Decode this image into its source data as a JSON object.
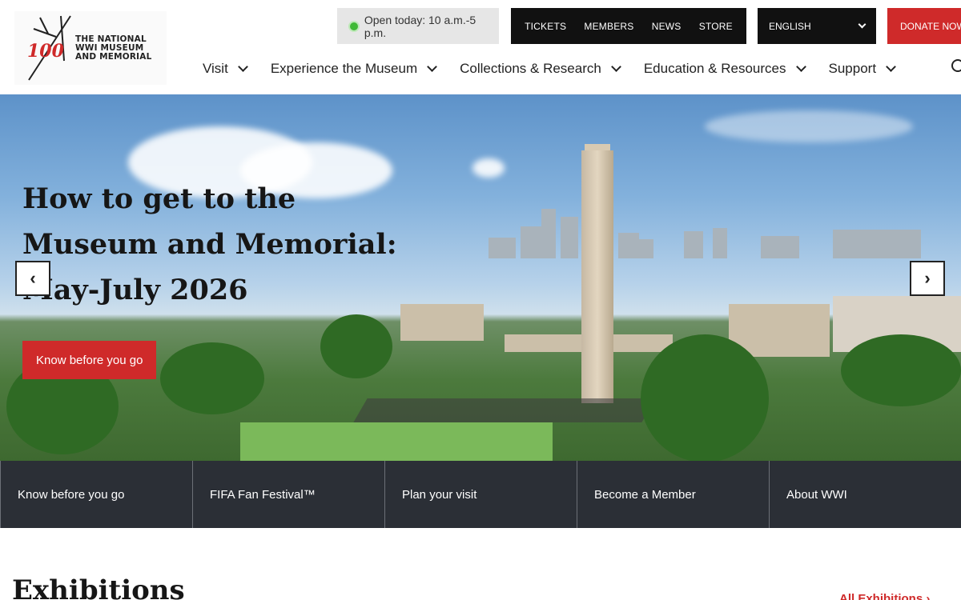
{
  "header": {
    "logo": {
      "mark_text": "100",
      "line1": "THE NATIONAL",
      "line2": "WWI MUSEUM",
      "line3": "AND MEMORIAL"
    },
    "hours": "Open today: 10 a.m.-5 p.m.",
    "utility_nav": [
      "TICKETS",
      "MEMBERS",
      "NEWS",
      "STORE"
    ],
    "language": "ENGLISH",
    "donate": "DONATE NOW",
    "main_nav": [
      "Visit",
      "Experience the Museum",
      "Collections & Research",
      "Education & Resources",
      "Support"
    ]
  },
  "hero": {
    "title": "How to get to the Museum and Memorial: May-July 2026",
    "cta": "Know before you go",
    "prev": "‹",
    "next": "›"
  },
  "quick_links": [
    "Know before you go",
    "FIFA Fan Festival™",
    "Plan your visit",
    "Become a Member",
    "About WWI"
  ],
  "exhibitions": {
    "title": "Exhibitions",
    "all_link": "All Exhibitions"
  },
  "colors": {
    "accent": "#cf2a2a",
    "dark": "#111111",
    "quickbar": "#2b2f36",
    "status": "#3fb935"
  },
  "icons": [
    "chevron-down-icon",
    "search-icon",
    "arrow-left-icon",
    "arrow-right-icon",
    "status-dot-icon"
  ]
}
